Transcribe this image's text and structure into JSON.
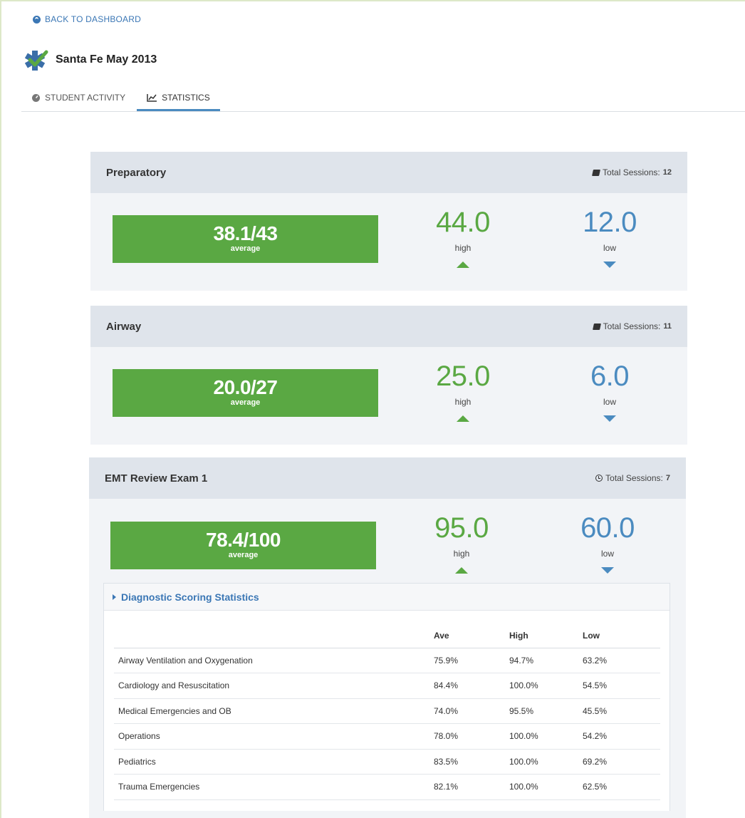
{
  "nav": {
    "back_label": "BACK TO DASHBOARD"
  },
  "course": {
    "title": "Santa Fe May 2013"
  },
  "tabs": [
    {
      "label": "STUDENT ACTIVITY",
      "active": false,
      "icon": "dashboard-icon"
    },
    {
      "label": "STATISTICS",
      "active": true,
      "icon": "line-chart-icon"
    }
  ],
  "cards": [
    {
      "title": "Preparatory",
      "sessions_label": "Total Sessions:",
      "sessions_value": "12",
      "sessions_icon": "book-icon",
      "average": "38.1/43",
      "average_label": "average",
      "high": "44.0",
      "high_label": "high",
      "low": "12.0",
      "low_label": "low"
    },
    {
      "title": "Airway",
      "sessions_label": "Total Sessions:",
      "sessions_value": "11",
      "sessions_icon": "book-icon",
      "average": "20.0/27",
      "average_label": "average",
      "high": "25.0",
      "high_label": "high",
      "low": "6.0",
      "low_label": "low"
    },
    {
      "title": "EMT Review Exam 1",
      "sessions_label": "Total Sessions:",
      "sessions_value": "7",
      "sessions_icon": "clock-icon",
      "average": "78.4/100",
      "average_label": "average",
      "high": "95.0",
      "high_label": "high",
      "low": "60.0",
      "low_label": "low"
    }
  ],
  "diagnostic": {
    "title": "Diagnostic Scoring Statistics",
    "columns": [
      "",
      "Ave",
      "High",
      "Low"
    ],
    "rows": [
      [
        "Airway Ventilation and Oxygenation",
        "75.9%",
        "94.7%",
        "63.2%"
      ],
      [
        "Cardiology and Resuscitation",
        "84.4%",
        "100.0%",
        "54.5%"
      ],
      [
        "Medical Emergencies and OB",
        "74.0%",
        "95.5%",
        "45.5%"
      ],
      [
        "Operations",
        "78.0%",
        "100.0%",
        "54.2%"
      ],
      [
        "Pediatrics",
        "83.5%",
        "100.0%",
        "69.2%"
      ],
      [
        "Trauma Emergencies",
        "82.1%",
        "100.0%",
        "62.5%"
      ]
    ]
  },
  "colors": {
    "green": "#5aa843",
    "blue": "#4b8bc0",
    "link": "#3b77b5"
  }
}
